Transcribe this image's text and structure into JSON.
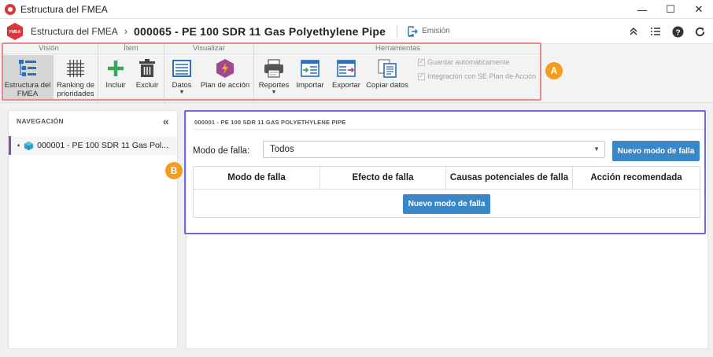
{
  "window": {
    "title": "Estructura del FMEA",
    "minimize": "—",
    "maximize": "☐",
    "close": "✕"
  },
  "header": {
    "logo_text": "FMEA",
    "parent": "Estructura del FMEA",
    "separator": "›",
    "title": "000065 - PE 100 SDR 11 Gas Polyethylene Pipe",
    "emission": "Emisión"
  },
  "ribbon": {
    "groups": [
      {
        "title": "Visión"
      },
      {
        "title": "Ítem"
      },
      {
        "title": "Visualizar"
      },
      {
        "title": "Herramientas"
      }
    ],
    "buttons": {
      "estructura": "Estructura del FMEA",
      "ranking": "Ranking de prioridades",
      "incluir": "Incluir",
      "excluir": "Excluir",
      "datos": "Datos",
      "plan": "Plan de acción",
      "reportes": "Reportes",
      "importar": "Importar",
      "exportar": "Exportar",
      "copiar": "Copiar datos"
    },
    "checkboxes": {
      "guardar": "Guardar automáticamente",
      "integracion": "Integración con SE Plan de Acción"
    }
  },
  "markers": {
    "a": "A",
    "b": "B"
  },
  "navigation": {
    "title": "NAVEGACIÓN",
    "collapse": "«",
    "item": "000001 - PE 100 SDR 11 Gas Pol..."
  },
  "main": {
    "title": "000001 - PE 100 SDR 11 GAS POLYETHYLENE PIPE",
    "mode_label": "Modo de falla:",
    "mode_value": "Todos",
    "new_button": "Nuevo modo de falla",
    "columns": [
      "Modo de falla",
      "Efecto de falla",
      "Causas potenciales de falla",
      "Acción recomendada"
    ],
    "empty_button": "Nuevo modo de falla"
  },
  "colors": {
    "accent": "#3a87c8",
    "annotation_a": "#e8888f",
    "annotation_b": "#6d6ae0",
    "marker": "#f39c1f",
    "nav_active": "#8a4ea3"
  }
}
